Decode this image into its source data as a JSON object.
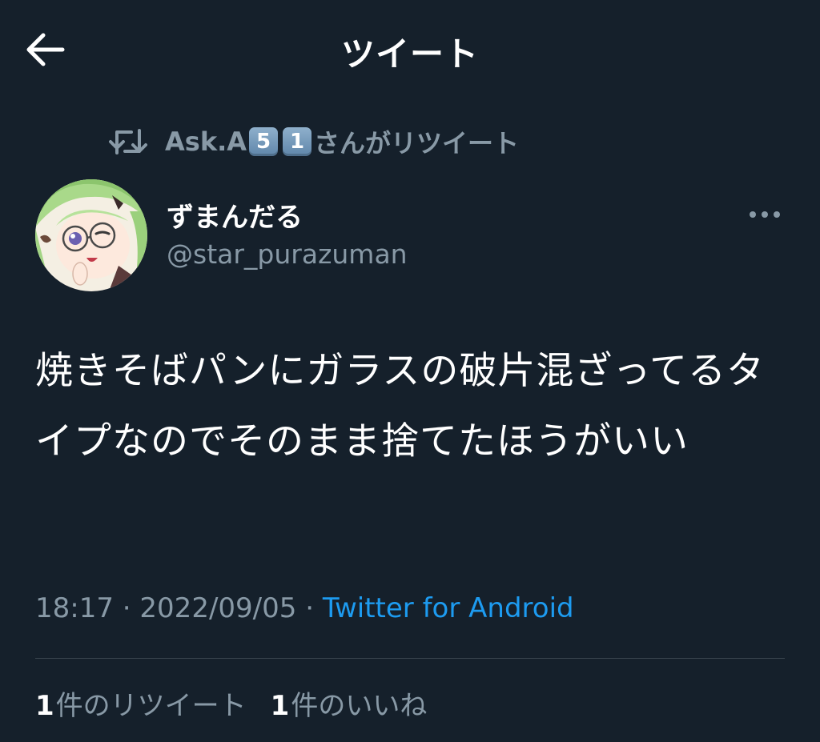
{
  "header": {
    "title": "ツイート",
    "back_icon": "back-arrow-icon"
  },
  "retweet_context": {
    "icon": "retweet-icon",
    "prefix": "Ask.A",
    "keycap_1": "5",
    "keycap_2": "1",
    "suffix": "さんがリツイート"
  },
  "tweet": {
    "display_name": "ずまんだる",
    "handle": "@star_purazuman",
    "text": "焼きそばパンにガラスの破片混ざってるタイプなのでそのまま捨てたほうがいい",
    "time": "18:17",
    "separator": "·",
    "date": "2022/09/05",
    "source": "Twitter for Android",
    "more_icon": "more-options-icon"
  },
  "stats": {
    "retweets_count": "1",
    "retweets_label": "件のリツイート",
    "likes_count": "1",
    "likes_label": "件のいいね"
  },
  "colors": {
    "background": "#15202b",
    "text": "#ffffff",
    "secondary": "#8899a6",
    "accent": "#1d9bf0",
    "divider": "#38444d"
  }
}
